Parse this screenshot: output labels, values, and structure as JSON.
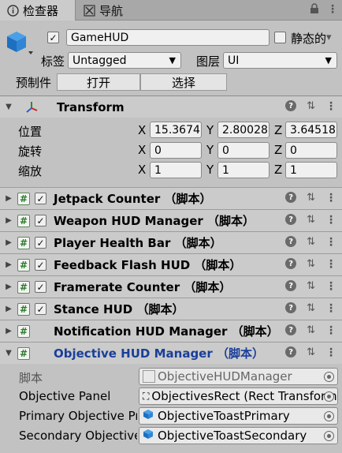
{
  "tabs": [
    {
      "label": "检查器",
      "icon": "info-icon"
    },
    {
      "label": "导航",
      "icon": "navigation-icon"
    }
  ],
  "header": {
    "object_name": "GameHUD",
    "active_checked": true,
    "static_label": "静态的",
    "tag_label": "标签",
    "tag_value": "Untagged",
    "layer_label": "图层",
    "layer_value": "UI",
    "prefab_label": "预制件",
    "open_button": "打开",
    "select_button": "选择"
  },
  "transform": {
    "title": "Transform",
    "rows": [
      {
        "label": "位置",
        "x": "15.3674",
        "y": "2.80028",
        "z": "3.645181"
      },
      {
        "label": "旋转",
        "x": "0",
        "y": "0",
        "z": "0"
      },
      {
        "label": "缩放",
        "x": "1",
        "y": "1",
        "z": "1"
      }
    ],
    "axis_x": "X",
    "axis_y": "Y",
    "axis_z": "Z"
  },
  "components": [
    {
      "name": "Jetpack Counter （脚本）",
      "checked": true
    },
    {
      "name": "Weapon HUD Manager （脚本）",
      "checked": true
    },
    {
      "name": "Player Health Bar （脚本）",
      "checked": true
    },
    {
      "name": "Feedback Flash HUD （脚本）",
      "checked": true
    },
    {
      "name": "Framerate Counter （脚本）",
      "checked": true
    },
    {
      "name": "Stance HUD （脚本）",
      "checked": true
    },
    {
      "name": "Notification HUD Manager （脚本）",
      "checked": false
    },
    {
      "name": "Objective HUD Manager （脚本）",
      "checked": false
    }
  ],
  "objective_fields": [
    {
      "label": "脚本",
      "value": "ObjectiveHUDManager",
      "icon": "script-icon"
    },
    {
      "label": "Objective Panel",
      "value": "ObjectivesRect (Rect Transform)",
      "icon": "rect-transform-icon"
    },
    {
      "label": "Primary Objective Prefab",
      "value": "ObjectiveToastPrimary",
      "icon": "prefab-cube-icon"
    },
    {
      "label": "Secondary Objective Prefab",
      "value": "ObjectiveToastSecondary",
      "icon": "prefab-cube-icon"
    }
  ],
  "colors": {
    "accent_blue": "#1a3f9a",
    "script_green": "#2a7a2a",
    "panel_bg": "#c2c2c2"
  }
}
